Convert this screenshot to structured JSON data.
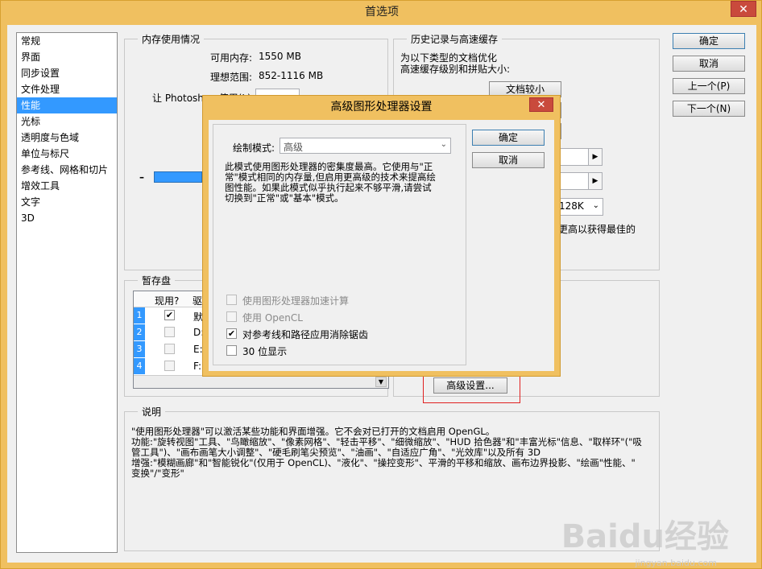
{
  "window": {
    "title": "首选项",
    "close_glyph": "✕"
  },
  "nav": {
    "items": [
      "常规",
      "界面",
      "同步设置",
      "文件处理",
      "性能",
      "光标",
      "透明度与色域",
      "单位与标尺",
      "参考线、网格和切片",
      "增效工具",
      "文字",
      "3D"
    ],
    "selected_index": 4
  },
  "buttons": {
    "ok": "确定",
    "cancel": "取消",
    "prev": "上一个(P)",
    "next": "下一个(N)"
  },
  "memory": {
    "title": "内存使用情况",
    "available_label": "可用内存:",
    "available_value": "1550 MB",
    "ideal_label": "理想范围:",
    "ideal_value": "852-1116 MB",
    "let_label": "让 Photoshop 使用(L):",
    "slider_minus": "–"
  },
  "history": {
    "title": "历史记录与高速缓存",
    "desc_line1": "为以下类型的文档优化",
    "desc_line2": "高速缓存级别和拼贴大小:",
    "doc_button": "文档较小",
    "tile_value": "128K",
    "tail_text": "更高以获得最佳的"
  },
  "scratch": {
    "title": "暂存盘",
    "col_active": "现用?",
    "col_drive": "驱",
    "rows": [
      {
        "num": "1",
        "checked": true,
        "drive": "默"
      },
      {
        "num": "2",
        "checked": false,
        "drive": "D:"
      },
      {
        "num": "3",
        "checked": false,
        "drive": "E:"
      },
      {
        "num": "4",
        "checked": false,
        "drive": "F:"
      }
    ]
  },
  "gpu": {
    "advanced_button": "高级设置..."
  },
  "description": {
    "title": "说明",
    "lines": [
      "\"使用图形处理器\"可以激活某些功能和界面增强。它不会对已打开的文档启用 OpenGL。",
      "功能:\"旋转视图\"工具、\"鸟瞰缩放\"、\"像素网格\"、\"轻击平移\"、\"细微缩放\"、\"HUD 拾色器\"和\"丰富光标\"信息、\"取样环\"(\"吸",
      "管工具\")、\"画布画笔大小调整\"、\"硬毛刷笔尖预览\"、\"油画\"、\"自适应广角\"、\"光效库\"以及所有 3D",
      "增强:\"模糊画廊\"和\"智能锐化\"(仅用于 OpenCL)、\"液化\"、\"操控变形\"、平滑的平移和缩放、画布边界投影、\"绘画\"性能、\"",
      "变换\"/\"变形\""
    ]
  },
  "modal": {
    "title": "高级图形处理器设置",
    "close_glyph": "✕",
    "mode_label": "绘制模式:",
    "mode_value": "高级",
    "desc_lines": [
      "此模式使用图形处理器的密集度最高。它使用与\"正",
      "常\"模式相同的内存量,但启用更高级的技术来提高绘",
      "图性能。如果此模式似乎执行起来不够平滑,请尝试",
      "切换到\"正常\"或\"基本\"模式。"
    ],
    "ok": "确定",
    "cancel": "取消",
    "opt_gpu_compute": "使用图形处理器加速计算",
    "opt_opencl": "使用 OpenCL",
    "opt_antialias": "对参考线和路径应用消除锯齿",
    "opt_30bit": "30 位显示",
    "antialias_checked": true,
    "bit30_checked": false
  },
  "watermark": {
    "text": "Baidu经验",
    "url": "jingyan.baidu.com"
  }
}
